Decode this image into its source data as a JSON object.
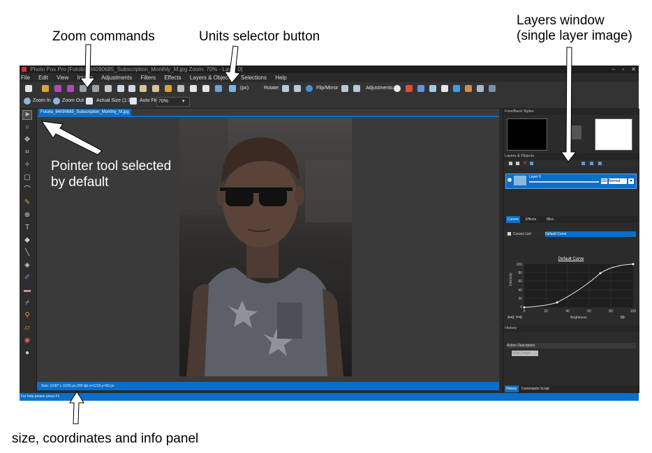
{
  "callouts": {
    "zoom": "Zoom commands",
    "units": "Units selector button",
    "layers_line1": "Layers window",
    "layers_line2": "(single layer image)",
    "pointer_line1": "Pointer tool selected",
    "pointer_line2": "by default",
    "info": "size, coordinates and info panel"
  },
  "window": {
    "title": "Photo Pos Pro [Fotolia_84090685_Subscription_Monthly_M.jpg Zoom: 70% - Layer 0]",
    "controls": [
      "–",
      "▫",
      "✕"
    ]
  },
  "menu": [
    "File",
    "Edit",
    "View",
    "Image",
    "Adjustments",
    "Filters",
    "Effects",
    "Layers & Objects",
    "Selections",
    "Help"
  ],
  "toolbar1": {
    "units": "(px)",
    "rotate": "Rotate:",
    "flip": "Flip/Mirror",
    "adjustments": "Adjustments:"
  },
  "toolbar2": {
    "zoom_in": "Zoom In",
    "zoom_out": "Zoom Out",
    "actual_size": "Actual Size (1:1)",
    "auto_fit": "Auto Fit",
    "zoom_value": "70%"
  },
  "document": {
    "tab": "Fotolia_84090685_Subscription_Monthly_M.jpg",
    "status": "Size: (1687 x 1126) px,300 dpi    x=1210,y=50 px"
  },
  "bottom_status": "For help please press F1",
  "panels": {
    "foreback": "Fore/Back Styles",
    "layers": "Layers & Objects",
    "layer_name": "Layer 0",
    "opacity": "100",
    "blend": "Normal",
    "tabs": [
      "Curves",
      "Effects",
      "Misc."
    ],
    "curves_list_label": "Curves List:",
    "curves_selected": "Default Curve",
    "curve_title": "Default Curve",
    "curve_ylabel": "Intensity",
    "curve_xlabel": "Brightness",
    "curve_yticks": [
      "100",
      "80",
      "60",
      "40",
      "20",
      "0"
    ],
    "curve_xticks": [
      "0",
      "20",
      "40",
      "60",
      "80",
      "100"
    ],
    "coords": "X=0, Y=0",
    "curve_value": "50",
    "history": "History",
    "history_col": "Action Description",
    "history_item": "Initial Image",
    "bottom_tabs": [
      "History",
      "Commands Script"
    ]
  },
  "colors": {
    "accent": "#0a6fc8",
    "dark": "#2b2b2b"
  }
}
